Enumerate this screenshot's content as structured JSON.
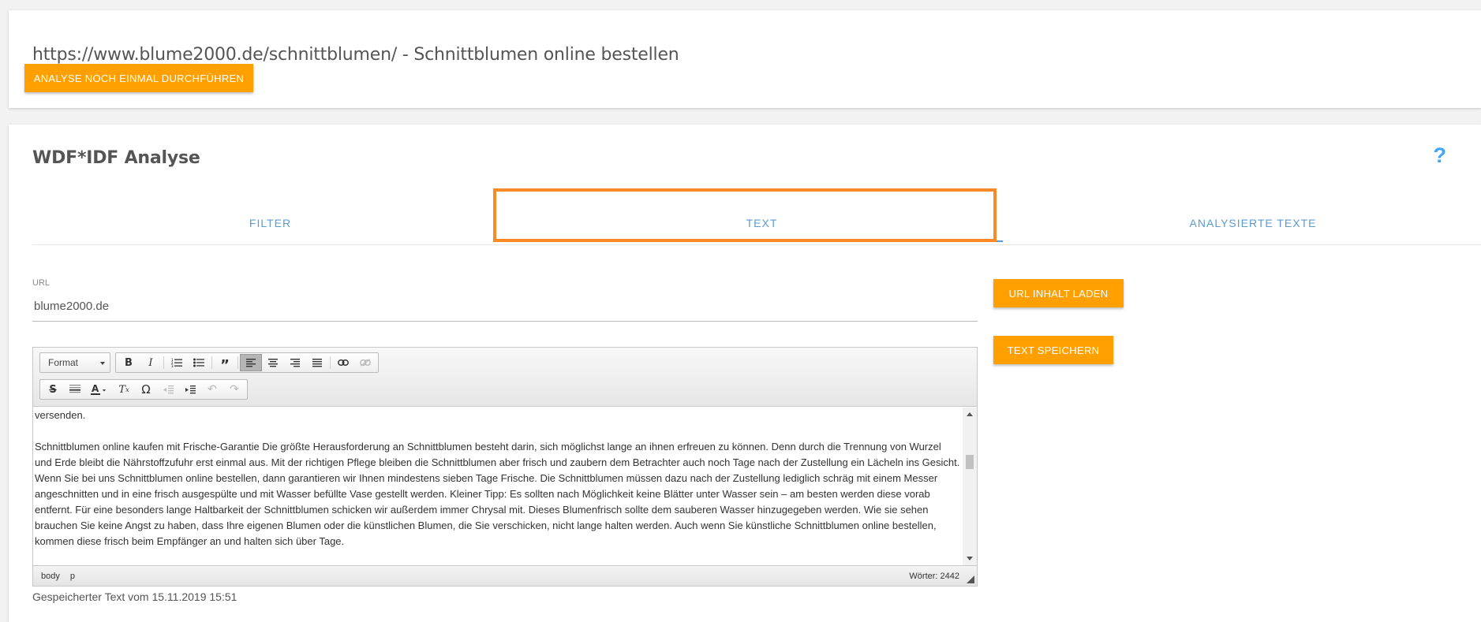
{
  "header": {
    "title": "https://www.blume2000.de/schnittblumen/ - Schnittblumen online bestellen",
    "rerun_button": "ANALYSE NOCH EINMAL DURCHFÜHREN"
  },
  "analysis": {
    "title": "WDF*IDF Analyse",
    "help": "?",
    "tabs": [
      {
        "label": "FILTER",
        "active": false
      },
      {
        "label": "TEXT",
        "active": true
      },
      {
        "label": "ANALYSIERTE TEXTE",
        "active": false
      }
    ]
  },
  "form": {
    "url_label": "URL",
    "url_value": "blume2000.de",
    "load_button": "URL INHALT LADEN",
    "save_button": "TEXT SPEICHERN"
  },
  "editor": {
    "format_label": "Format",
    "paragraphs": [
      "versenden.",
      "Schnittblumen online kaufen mit Frische-Garantie Die größte Herausforderung an Schnittblumen besteht darin, sich möglichst lange an ihnen erfreuen zu können. Denn durch die Trennung von Wurzel und Erde bleibt die Nährstoffzufuhr erst einmal aus. Mit der richtigen Pflege bleiben die Schnittblumen aber frisch und zaubern dem Betrachter auch noch Tage nach der Zustellung ein Lächeln ins Gesicht. Wenn Sie bei uns Schnittblumen online bestellen, dann garantieren wir Ihnen mindestens sieben Tage Frische. Die Schnittblumen müssen dazu nach der Zustellung lediglich schräg mit einem Messer angeschnitten und in eine frisch ausgespülte und mit Wasser befüllte Vase gestellt werden. Kleiner Tipp: Es sollten nach Möglichkeit keine Blätter unter Wasser sein – am besten werden diese vorab entfernt. Für eine besonders lange Haltbarkeit der Schnittblumen schicken wir außerdem immer Chrysal mit. Dieses Blumenfrisch sollte dem sauberen Wasser hinzugegeben werden. Wie sie sehen brauchen Sie keine Angst zu haben, dass Ihre eigenen Blumen oder die künstlichen Blumen, die Sie verschicken, nicht lange halten werden. Auch wenn Sie künstliche Schnittblumen online bestellen, kommen diese frisch beim Empfänger an und halten sich über Tage."
    ],
    "path": [
      "body",
      "p"
    ],
    "word_count": "Wörter: 2442"
  },
  "saved_note": "Gespeicherter Text vom 15.11.2019 15:51",
  "colors": {
    "accent_orange": "#ffa000",
    "tab_blue": "#5c9bd1",
    "highlight_orange": "#f98a27",
    "help_blue": "#42a5f5"
  },
  "icons": {
    "toolbar_row1": [
      "bold-icon",
      "italic-icon",
      "numbered-list-icon",
      "bulleted-list-icon",
      "blockquote-icon",
      "align-left-icon",
      "align-center-icon",
      "align-right-icon",
      "justify-icon",
      "link-icon",
      "unlink-icon"
    ],
    "toolbar_row2": [
      "strikethrough-icon",
      "horizontal-line-icon",
      "text-color-icon",
      "clear-format-icon",
      "special-char-icon",
      "outdent-icon",
      "indent-icon",
      "undo-icon",
      "redo-icon"
    ]
  }
}
